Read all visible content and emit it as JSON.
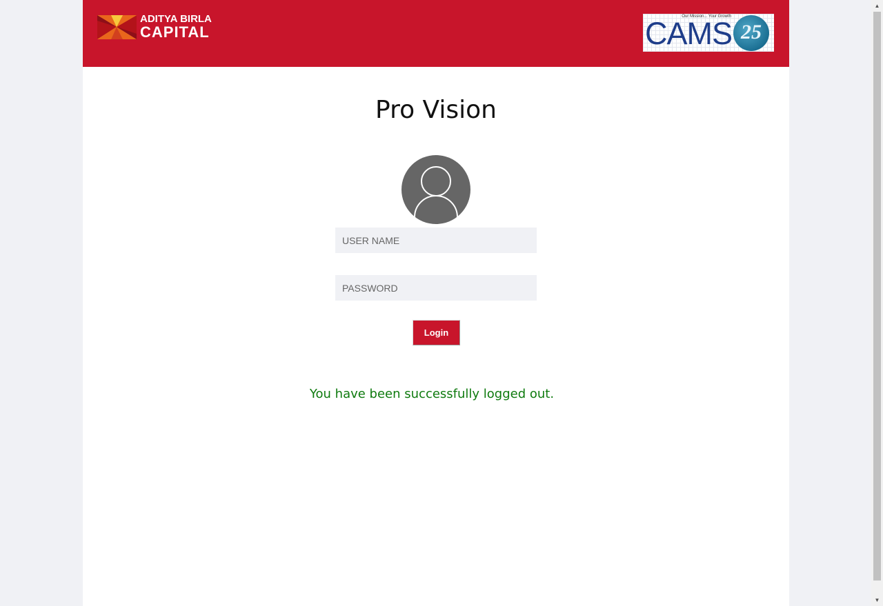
{
  "header": {
    "brand_line1": "ADITYA BIRLA",
    "brand_line2": "CAPITAL",
    "partner_wordmark": "CAMS",
    "partner_tagline": "Our Mission... Your Growth",
    "partner_anniversary": "25",
    "brand_color": "#c8152b"
  },
  "login": {
    "title": "Pro Vision",
    "avatar_icon": "user-avatar-icon",
    "username_placeholder": "USER NAME",
    "username_value": "",
    "password_placeholder": "PASSWORD",
    "password_value": "",
    "login_label": "Login"
  },
  "status": {
    "message": "You have been successfully logged out.",
    "message_color": "#0e7a0e"
  }
}
